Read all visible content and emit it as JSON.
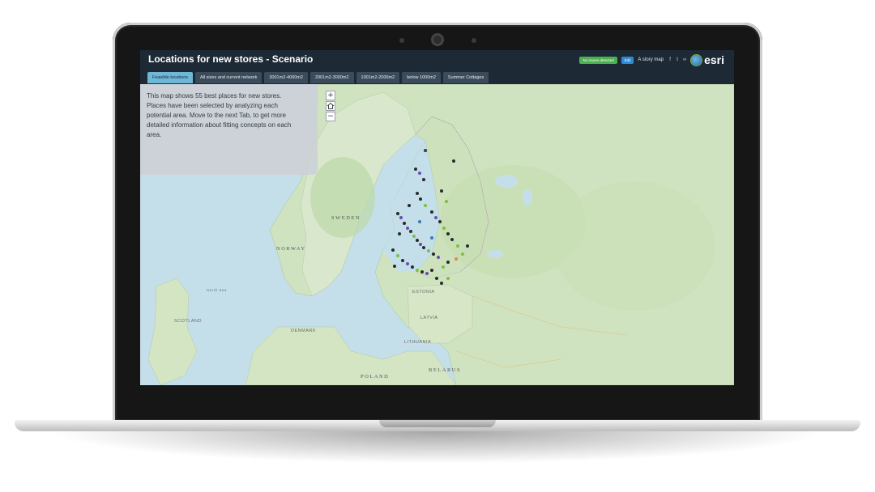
{
  "app": {
    "title": "Locations for new stores  - Scenario",
    "no_issues_label": "No issues detected",
    "edit_label": "Edit",
    "story_map_label": "A story map",
    "logo_text": "esri"
  },
  "tabs": [
    {
      "label": "Feasible locations",
      "active": true
    },
    {
      "label": "All sizes and current network",
      "active": false
    },
    {
      "label": "3001m2-4000m2",
      "active": false
    },
    {
      "label": "2001m2-3000m2",
      "active": false
    },
    {
      "label": "1001m2-2000m2",
      "active": false
    },
    {
      "label": "below 1000m2",
      "active": false
    },
    {
      "label": "Summer Cottages",
      "active": false
    }
  ],
  "info_panel": {
    "lines": [
      "This map shows 55 best places for new stores.",
      "Places have been selected by analyzing each",
      "potential area. Move to the next Tab, to get more",
      "detailed information about fitting concepts on each",
      "area."
    ]
  },
  "zoom": {
    "plus": "+",
    "home_icon": "home-icon",
    "minus": "−"
  },
  "map_labels": {
    "sweden": "SWEDEN",
    "norway": "NORWAY",
    "estonia": "ESTONIA",
    "latvia": "LATVIA",
    "lithuania": "LITHUANIA",
    "belarus": "BELARUS",
    "poland": "POLAND",
    "denmark": "DENMARK",
    "scotland": "SCOTLAND",
    "north_sea": "North Sea"
  },
  "colors": {
    "header": "#1d2a36",
    "active_tab": "#6fb7d6",
    "water": "#c4dfe9",
    "land": "#cfe3c1",
    "marker_green": "#7ac143",
    "marker_purple": "#6a4fa8"
  }
}
